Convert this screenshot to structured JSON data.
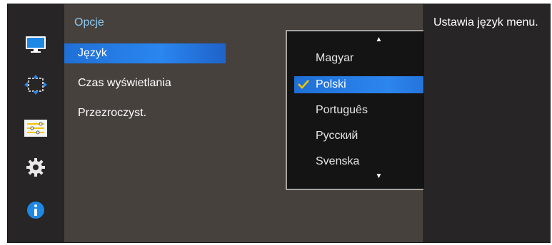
{
  "left_bar": {
    "icons": [
      "monitor-icon",
      "move-position-icon",
      "options-sliders-icon",
      "gear-icon",
      "info-icon"
    ],
    "active_index": 2
  },
  "main": {
    "title": "Opcje",
    "menu": [
      {
        "label": "Język",
        "active": true
      },
      {
        "label": "Czas wyświetlania",
        "active": false
      },
      {
        "label": "Przezroczyst.",
        "active": false
      }
    ]
  },
  "dropdown": {
    "up_arrow": "▲",
    "down_arrow": "▼",
    "items": [
      {
        "label": "Magyar"
      },
      {
        "label": "Polski"
      },
      {
        "label": "Português"
      },
      {
        "label": "Русский"
      },
      {
        "label": "Svenska"
      }
    ],
    "selected_index": 1
  },
  "info": {
    "text": "Ustawia język menu."
  },
  "colors": {
    "accent_blue": "#2a86f0",
    "title_blue": "#8ec8ef",
    "check_yellow": "#f5c400"
  }
}
